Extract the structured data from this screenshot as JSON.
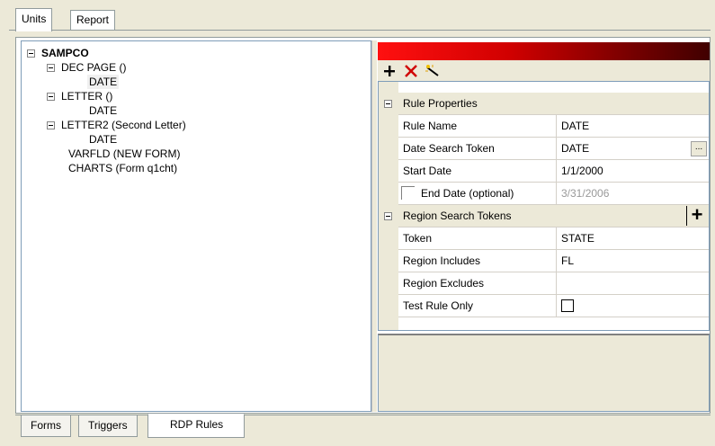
{
  "top_tabs": [
    "Units",
    "Report"
  ],
  "tree": {
    "root": "SAMPCO",
    "nodes": [
      {
        "label": "DEC PAGE ()",
        "children": [
          "DATE"
        ]
      },
      {
        "label": "LETTER ()",
        "children": [
          "DATE"
        ]
      },
      {
        "label": "LETTER2 (Second Letter)",
        "children": [
          "DATE"
        ]
      },
      {
        "label": "VARFLD (NEW FORM)",
        "children": []
      },
      {
        "label": "CHARTS (Form q1cht)",
        "children": []
      }
    ]
  },
  "toolbar": {
    "add_icon": "plus-icon",
    "delete_icon": "red-x-icon",
    "wand_icon": "magic-wand-icon"
  },
  "grid": {
    "rule_properties": {
      "category": "Rule Properties",
      "rule_name_label": "Rule Name",
      "rule_name_value": "DATE",
      "date_token_label": "Date Search Token",
      "date_token_value": "DATE",
      "ellipsis": "...",
      "start_date_label": "Start Date",
      "start_date_value": "1/1/2000",
      "end_date_label": "End Date (optional)",
      "end_date_value": "3/31/2006"
    },
    "region_tokens": {
      "category": "Region Search Tokens",
      "add_symbol": "+",
      "token_label": "Token",
      "token_value": "STATE",
      "includes_label": "Region Includes",
      "includes_value": "FL",
      "excludes_label": "Region Excludes",
      "excludes_value": "",
      "test_label": "Test Rule Only"
    }
  },
  "bottom_tabs": [
    "Forms",
    "Triggers",
    "RDP Rules"
  ],
  "colors": {
    "accent_red": "#d00000",
    "panel_bg": "#ece9d8",
    "border": "#7f9db9"
  }
}
